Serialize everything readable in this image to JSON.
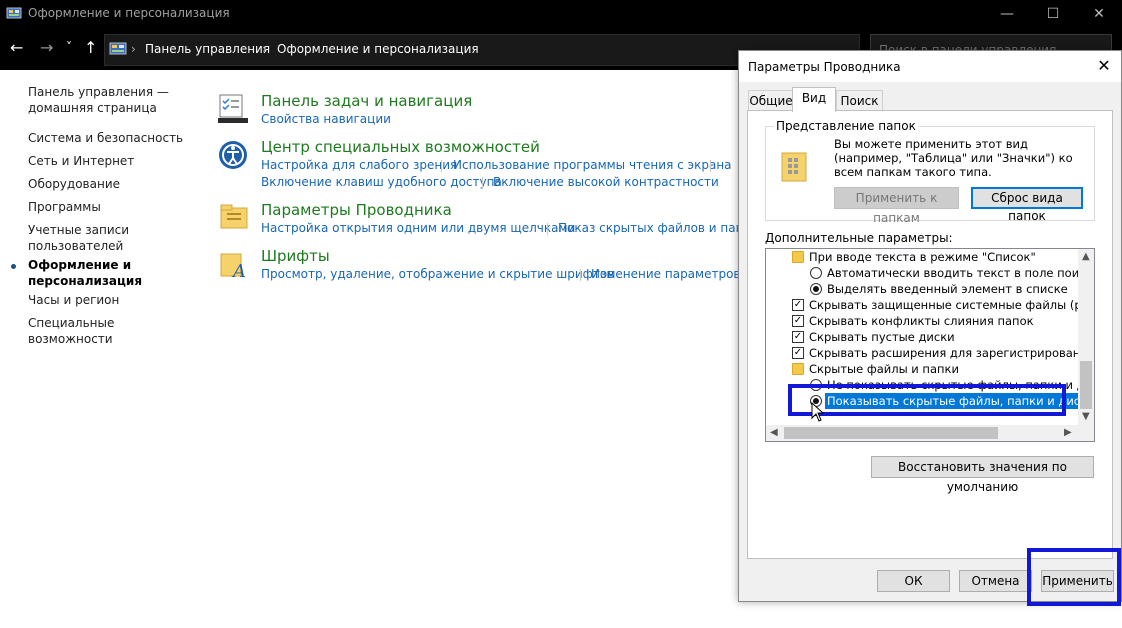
{
  "window": {
    "title": "Оформление и персонализация",
    "minimize": "—",
    "maximize": "☐",
    "close": "✕"
  },
  "address": {
    "back": "←",
    "forward": "→",
    "history": "˅",
    "up": "↑",
    "crumbs": [
      "Панель управления",
      "Оформление и персонализация"
    ],
    "separator": "›",
    "search_placeholder": "Поиск в панели управления"
  },
  "sidebar": {
    "items": [
      "Панель управления — домашняя страница",
      "Система и безопасность",
      "Сеть и Интернет",
      "Оборудование",
      "Программы",
      "Учетные записи пользователей",
      "Оформление и персонализация",
      "Часы и регион",
      "Специальные возможности"
    ],
    "active_index": 6
  },
  "categories": [
    {
      "title": "Панель задач и навигация",
      "links": [
        "Свойства навигации"
      ]
    },
    {
      "title": "Центр специальных возможностей",
      "links": [
        "Настройка для слабого зрения",
        "Использование программы чтения с экрана",
        "Включение клавиш удобного доступа",
        "Включение высокой контрастности"
      ]
    },
    {
      "title": "Параметры Проводника",
      "links": [
        "Настройка открытия одним или двумя щелчками",
        "Показ скрытых файлов и папок"
      ]
    },
    {
      "title": "Шрифты",
      "links": [
        "Просмотр, удаление, отображение и скрытие шрифтов",
        "Изменение параметров шриф"
      ]
    }
  ],
  "dialog": {
    "title": "Параметры Проводника",
    "close": "✕",
    "tabs": [
      "Общие",
      "Вид",
      "Поиск"
    ],
    "active_tab": 1,
    "folder_views": {
      "legend": "Представление папок",
      "description": "Вы можете применить этот вид (например, \"Таблица\" или \"Значки\") ко всем папкам такого типа.",
      "apply_button": "Применить к папкам",
      "reset_button": "Сброс вида папок"
    },
    "advanced_label": "Дополнительные параметры:",
    "tree": [
      {
        "type": "folder",
        "text": "При вводе текста в режиме \"Список\""
      },
      {
        "type": "radio",
        "checked": false,
        "text": "Автоматически вводить текст в поле поиска"
      },
      {
        "type": "radio",
        "checked": true,
        "text": "Выделять введенный элемент в списке"
      },
      {
        "type": "check",
        "checked": true,
        "text": "Скрывать защищенные системные файлы (рекомен"
      },
      {
        "type": "check",
        "checked": true,
        "text": "Скрывать конфликты слияния папок"
      },
      {
        "type": "check",
        "checked": true,
        "text": "Скрывать пустые диски"
      },
      {
        "type": "check",
        "checked": true,
        "text": "Скрывать расширения для зарегистрированных типо"
      },
      {
        "type": "folder",
        "text": "Скрытые файлы и папки"
      },
      {
        "type": "radio",
        "checked": false,
        "text": "Не показывать скрытые файлы, папки и диски"
      },
      {
        "type": "radio",
        "checked": true,
        "text": "Показывать скрытые файлы, папки и диски",
        "selected": true
      }
    ],
    "restore_button": "Восстановить значения по умолчанию",
    "ok_button": "ОК",
    "cancel_button": "Отмена",
    "apply_button": "Применить"
  },
  "colors": {
    "highlight": "#1119d6",
    "category_title": "#1e7a1e",
    "link": "#1766b3",
    "selection": "#0078d7"
  }
}
